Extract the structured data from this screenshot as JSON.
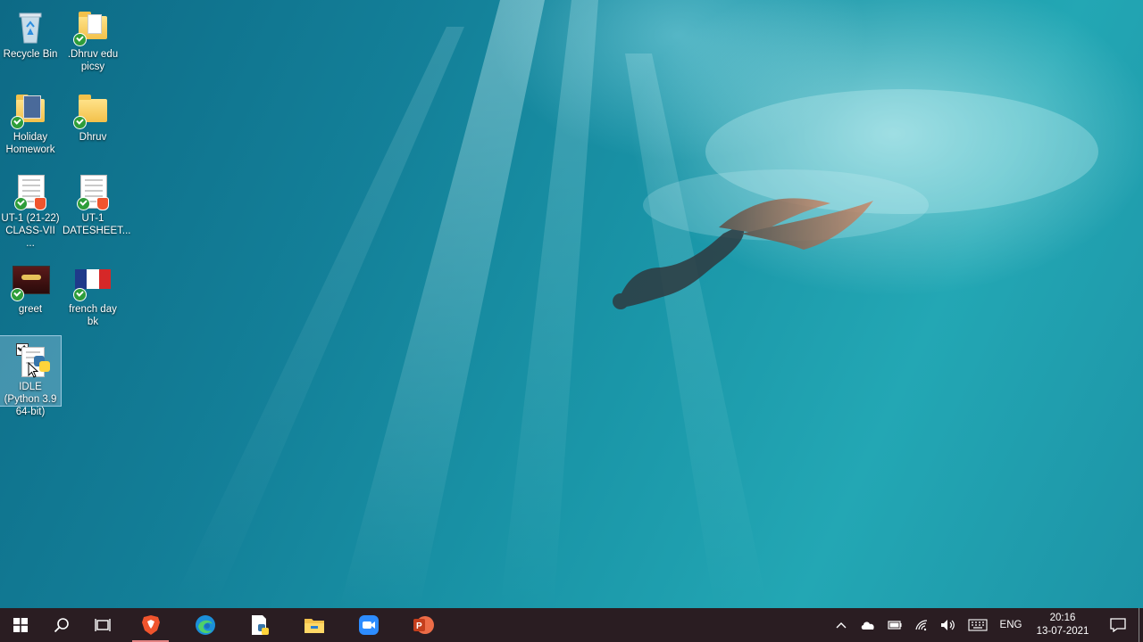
{
  "desktop": {
    "icons": [
      {
        "label": "Recycle Bin",
        "icon": "recycle-bin-icon"
      },
      {
        "label": ".Dhruv edu picsy",
        "icon": "folder-icon"
      },
      {
        "label": "Holiday Homework",
        "icon": "folder-icon"
      },
      {
        "label": "Dhruv",
        "icon": "folder-icon"
      },
      {
        "label": "UT-1 (21-22) CLASS-VII ...",
        "icon": "pdf-document-icon"
      },
      {
        "label": "UT-1 DATESHEET...",
        "icon": "pdf-document-icon"
      },
      {
        "label": "greet",
        "icon": "image-icon"
      },
      {
        "label": "french day bk",
        "icon": "image-icon"
      },
      {
        "label": "IDLE (Python 3.9 64-bit)",
        "icon": "python-idle-icon"
      }
    ]
  },
  "taskbar": {
    "apps": [
      "start-icon",
      "search-icon",
      "task-view-icon",
      "brave-browser-icon",
      "edge-browser-icon",
      "python-file-icon",
      "file-explorer-icon",
      "zoom-icon",
      "powerpoint-icon"
    ],
    "tray": {
      "language": "ENG",
      "time": "20:16",
      "date": "13-07-2021"
    }
  },
  "colors": {
    "taskbar": "#2a1d22",
    "active_indicator": "#e58383"
  }
}
